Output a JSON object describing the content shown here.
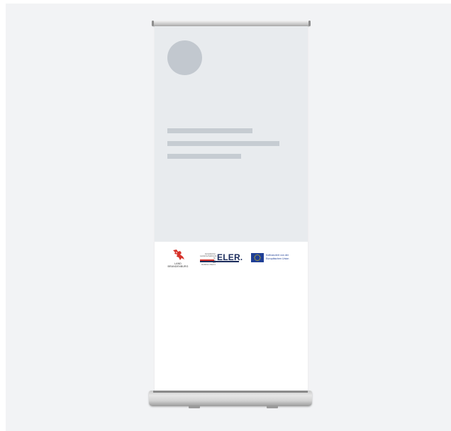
{
  "banner": {
    "logos": {
      "brandenburg": {
        "icon": "brandenburg-eagle-icon",
        "line1": "LAND",
        "line2": "BRANDENBURG",
        "color": "#d6322a"
      },
      "eler": {
        "small_text_1": "Europäischer",
        "small_text_2": "Landwirtschaftsfonds für",
        "small_text_3": "die Entwicklung des",
        "small_text_4": "ländlichen Raums",
        "wordmark": "ELER.",
        "color": "#1b2c5c"
      },
      "eu": {
        "icon": "eu-flag-icon",
        "line1": "Kofinanziert von der",
        "line2": "Europäischen Union",
        "color": "#1f3f96"
      }
    },
    "colors": {
      "placeholder_background": "#e8ebee",
      "placeholder_shape": "#c2c8cf"
    }
  }
}
